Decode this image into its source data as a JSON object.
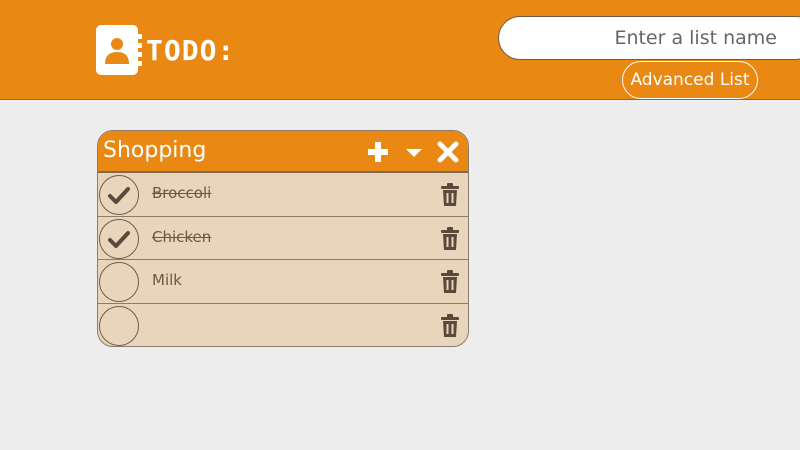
{
  "app": {
    "logo_text": "TODO:"
  },
  "search": {
    "placeholder": "Enter a list name"
  },
  "advanced_button": {
    "label": "Advanced List"
  },
  "list": {
    "title": "Shopping",
    "items": [
      {
        "text": "Broccoli",
        "checked": true
      },
      {
        "text": "Chicken",
        "checked": true
      },
      {
        "text": "Milk",
        "checked": false
      },
      {
        "text": "",
        "checked": false
      }
    ]
  },
  "colors": {
    "accent": "#e98813",
    "card_body": "#e8d5bc",
    "background": "#ededed",
    "icon_dark": "#5b4a3c"
  },
  "icons": {
    "logo": "address-book-icon",
    "add": "plus-icon",
    "collapse": "caret-down-icon",
    "close": "close-icon",
    "check": "checkmark-icon",
    "delete": "trash-icon"
  }
}
